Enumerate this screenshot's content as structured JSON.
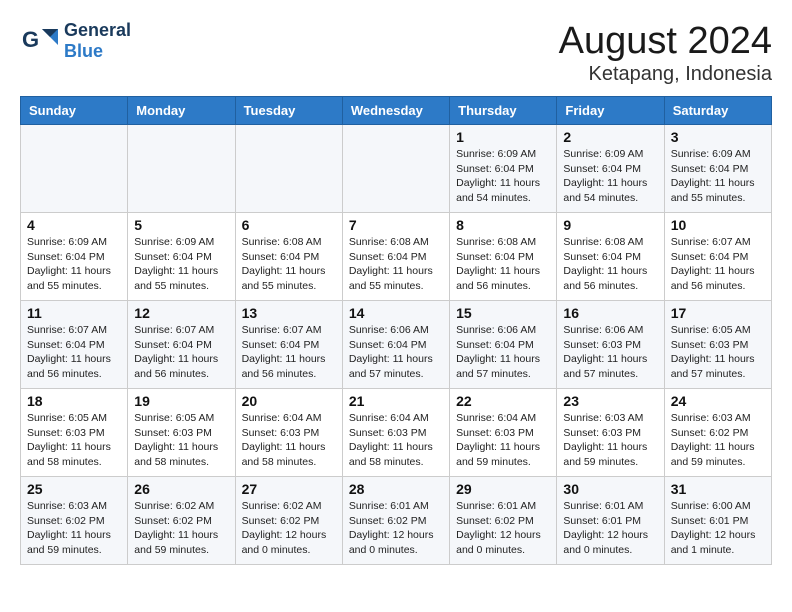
{
  "header": {
    "logo_general": "General",
    "logo_blue": "Blue",
    "month_year": "August 2024",
    "location": "Ketapang, Indonesia"
  },
  "weekdays": [
    "Sunday",
    "Monday",
    "Tuesday",
    "Wednesday",
    "Thursday",
    "Friday",
    "Saturday"
  ],
  "weeks": [
    [
      {
        "day": "",
        "info": ""
      },
      {
        "day": "",
        "info": ""
      },
      {
        "day": "",
        "info": ""
      },
      {
        "day": "",
        "info": ""
      },
      {
        "day": "1",
        "info": "Sunrise: 6:09 AM\nSunset: 6:04 PM\nDaylight: 11 hours\nand 54 minutes."
      },
      {
        "day": "2",
        "info": "Sunrise: 6:09 AM\nSunset: 6:04 PM\nDaylight: 11 hours\nand 54 minutes."
      },
      {
        "day": "3",
        "info": "Sunrise: 6:09 AM\nSunset: 6:04 PM\nDaylight: 11 hours\nand 55 minutes."
      }
    ],
    [
      {
        "day": "4",
        "info": "Sunrise: 6:09 AM\nSunset: 6:04 PM\nDaylight: 11 hours\nand 55 minutes."
      },
      {
        "day": "5",
        "info": "Sunrise: 6:09 AM\nSunset: 6:04 PM\nDaylight: 11 hours\nand 55 minutes."
      },
      {
        "day": "6",
        "info": "Sunrise: 6:08 AM\nSunset: 6:04 PM\nDaylight: 11 hours\nand 55 minutes."
      },
      {
        "day": "7",
        "info": "Sunrise: 6:08 AM\nSunset: 6:04 PM\nDaylight: 11 hours\nand 55 minutes."
      },
      {
        "day": "8",
        "info": "Sunrise: 6:08 AM\nSunset: 6:04 PM\nDaylight: 11 hours\nand 56 minutes."
      },
      {
        "day": "9",
        "info": "Sunrise: 6:08 AM\nSunset: 6:04 PM\nDaylight: 11 hours\nand 56 minutes."
      },
      {
        "day": "10",
        "info": "Sunrise: 6:07 AM\nSunset: 6:04 PM\nDaylight: 11 hours\nand 56 minutes."
      }
    ],
    [
      {
        "day": "11",
        "info": "Sunrise: 6:07 AM\nSunset: 6:04 PM\nDaylight: 11 hours\nand 56 minutes."
      },
      {
        "day": "12",
        "info": "Sunrise: 6:07 AM\nSunset: 6:04 PM\nDaylight: 11 hours\nand 56 minutes."
      },
      {
        "day": "13",
        "info": "Sunrise: 6:07 AM\nSunset: 6:04 PM\nDaylight: 11 hours\nand 56 minutes."
      },
      {
        "day": "14",
        "info": "Sunrise: 6:06 AM\nSunset: 6:04 PM\nDaylight: 11 hours\nand 57 minutes."
      },
      {
        "day": "15",
        "info": "Sunrise: 6:06 AM\nSunset: 6:04 PM\nDaylight: 11 hours\nand 57 minutes."
      },
      {
        "day": "16",
        "info": "Sunrise: 6:06 AM\nSunset: 6:03 PM\nDaylight: 11 hours\nand 57 minutes."
      },
      {
        "day": "17",
        "info": "Sunrise: 6:05 AM\nSunset: 6:03 PM\nDaylight: 11 hours\nand 57 minutes."
      }
    ],
    [
      {
        "day": "18",
        "info": "Sunrise: 6:05 AM\nSunset: 6:03 PM\nDaylight: 11 hours\nand 58 minutes."
      },
      {
        "day": "19",
        "info": "Sunrise: 6:05 AM\nSunset: 6:03 PM\nDaylight: 11 hours\nand 58 minutes."
      },
      {
        "day": "20",
        "info": "Sunrise: 6:04 AM\nSunset: 6:03 PM\nDaylight: 11 hours\nand 58 minutes."
      },
      {
        "day": "21",
        "info": "Sunrise: 6:04 AM\nSunset: 6:03 PM\nDaylight: 11 hours\nand 58 minutes."
      },
      {
        "day": "22",
        "info": "Sunrise: 6:04 AM\nSunset: 6:03 PM\nDaylight: 11 hours\nand 59 minutes."
      },
      {
        "day": "23",
        "info": "Sunrise: 6:03 AM\nSunset: 6:03 PM\nDaylight: 11 hours\nand 59 minutes."
      },
      {
        "day": "24",
        "info": "Sunrise: 6:03 AM\nSunset: 6:02 PM\nDaylight: 11 hours\nand 59 minutes."
      }
    ],
    [
      {
        "day": "25",
        "info": "Sunrise: 6:03 AM\nSunset: 6:02 PM\nDaylight: 11 hours\nand 59 minutes."
      },
      {
        "day": "26",
        "info": "Sunrise: 6:02 AM\nSunset: 6:02 PM\nDaylight: 11 hours\nand 59 minutes."
      },
      {
        "day": "27",
        "info": "Sunrise: 6:02 AM\nSunset: 6:02 PM\nDaylight: 12 hours\nand 0 minutes."
      },
      {
        "day": "28",
        "info": "Sunrise: 6:01 AM\nSunset: 6:02 PM\nDaylight: 12 hours\nand 0 minutes."
      },
      {
        "day": "29",
        "info": "Sunrise: 6:01 AM\nSunset: 6:02 PM\nDaylight: 12 hours\nand 0 minutes."
      },
      {
        "day": "30",
        "info": "Sunrise: 6:01 AM\nSunset: 6:01 PM\nDaylight: 12 hours\nand 0 minutes."
      },
      {
        "day": "31",
        "info": "Sunrise: 6:00 AM\nSunset: 6:01 PM\nDaylight: 12 hours\nand 1 minute."
      }
    ]
  ]
}
